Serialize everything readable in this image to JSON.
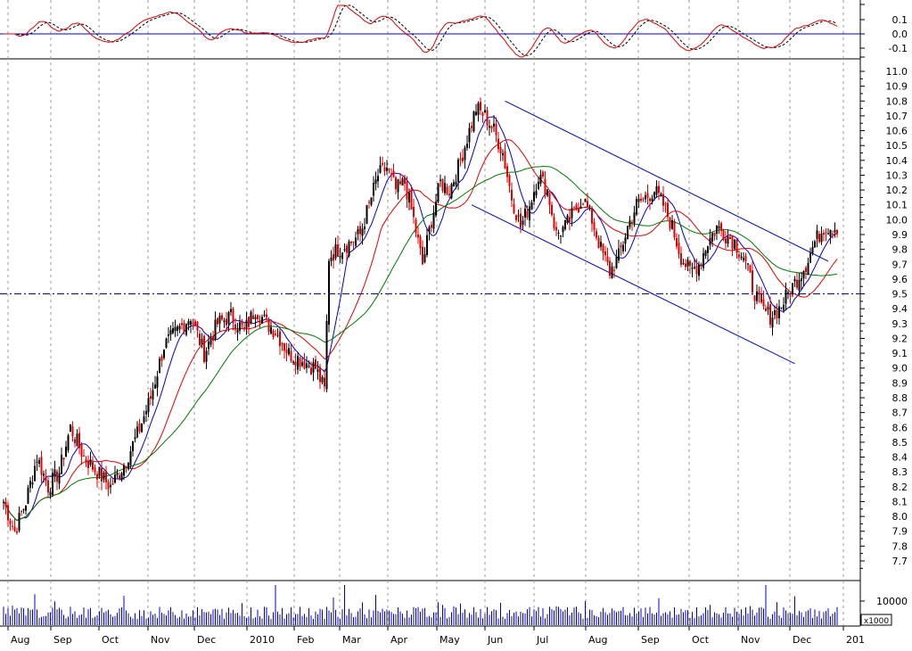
{
  "chart_data": {
    "type": "candlestick",
    "x_labels": [
      "Aug",
      "Sep",
      "Oct",
      "Nov",
      "Dec",
      "2010",
      "Feb",
      "Mar",
      "Apr",
      "May",
      "Jun",
      "Jul",
      "Aug",
      "Sep",
      "Oct",
      "Nov",
      "Dec",
      "201"
    ],
    "price_axis": {
      "ylim": [
        7.6,
        11.1
      ],
      "ticks": [
        "7.7",
        "7.8",
        "7.9",
        "8.0",
        "8.1",
        "8.2",
        "8.3",
        "8.4",
        "8.5",
        "8.6",
        "8.7",
        "8.8",
        "8.9",
        "9.0",
        "9.1",
        "9.2",
        "9.3",
        "9.4",
        "9.5",
        "9.6",
        "9.7",
        "9.8",
        "9.9",
        "10.0",
        "10.1",
        "10.2",
        "10.3",
        "10.4",
        "10.5",
        "10.6",
        "10.7",
        "10.8",
        "10.9",
        "11.0"
      ],
      "support_level": 9.5
    },
    "oscillator": {
      "ylim": [
        -0.18,
        0.2
      ],
      "ticks": [
        "0.1",
        "0.0",
        "-0.1"
      ],
      "zero_line": 0.0
    },
    "volume": {
      "ticks": [
        "10000"
      ],
      "multiplier": "x1000"
    },
    "price_anchors": [
      [
        0,
        8.1
      ],
      [
        5,
        7.9
      ],
      [
        10,
        8.1
      ],
      [
        15,
        8.4
      ],
      [
        20,
        8.2
      ],
      [
        25,
        8.3
      ],
      [
        30,
        8.6
      ],
      [
        36,
        8.4
      ],
      [
        42,
        8.3
      ],
      [
        48,
        8.2
      ],
      [
        54,
        8.35
      ],
      [
        60,
        8.55
      ],
      [
        66,
        8.8
      ],
      [
        72,
        9.15
      ],
      [
        78,
        9.25
      ],
      [
        84,
        9.35
      ],
      [
        90,
        9.1
      ],
      [
        96,
        9.3
      ],
      [
        102,
        9.35
      ],
      [
        108,
        9.25
      ],
      [
        113,
        9.4
      ],
      [
        118,
        9.3
      ],
      [
        122,
        9.25
      ],
      [
        128,
        9.1
      ],
      [
        134,
        9.05
      ],
      [
        140,
        9.0
      ],
      [
        144,
        8.85
      ],
      [
        146,
        9.75
      ],
      [
        150,
        9.8
      ],
      [
        156,
        9.85
      ],
      [
        160,
        9.9
      ],
      [
        164,
        10.1
      ],
      [
        168,
        10.3
      ],
      [
        172,
        10.35
      ],
      [
        176,
        10.2
      ],
      [
        180,
        10.25
      ],
      [
        184,
        10.0
      ],
      [
        188,
        9.7
      ],
      [
        192,
        10.0
      ],
      [
        196,
        10.25
      ],
      [
        200,
        10.2
      ],
      [
        204,
        10.35
      ],
      [
        208,
        10.55
      ],
      [
        212,
        10.75
      ],
      [
        216,
        10.7
      ],
      [
        220,
        10.6
      ],
      [
        224,
        10.45
      ],
      [
        228,
        10.15
      ],
      [
        232,
        9.95
      ],
      [
        236,
        10.1
      ],
      [
        240,
        10.3
      ],
      [
        244,
        10.2
      ],
      [
        248,
        9.9
      ],
      [
        252,
        9.95
      ],
      [
        256,
        10.05
      ],
      [
        260,
        10.15
      ],
      [
        264,
        10.0
      ],
      [
        268,
        9.8
      ],
      [
        272,
        9.65
      ],
      [
        276,
        9.75
      ],
      [
        280,
        9.95
      ],
      [
        284,
        10.1
      ],
      [
        288,
        10.15
      ],
      [
        292,
        10.2
      ],
      [
        296,
        10.1
      ],
      [
        300,
        9.95
      ],
      [
        304,
        9.75
      ],
      [
        308,
        9.65
      ],
      [
        312,
        9.7
      ],
      [
        316,
        9.85
      ],
      [
        320,
        9.95
      ],
      [
        324,
        9.9
      ],
      [
        328,
        9.85
      ],
      [
        332,
        9.75
      ],
      [
        336,
        9.55
      ],
      [
        340,
        9.4
      ],
      [
        344,
        9.35
      ],
      [
        348,
        9.4
      ],
      [
        352,
        9.5
      ],
      [
        356,
        9.6
      ],
      [
        360,
        9.7
      ],
      [
        364,
        9.85
      ],
      [
        368,
        9.95
      ]
    ],
    "channel_upper": [
      [
        225,
        10.8
      ],
      [
        370,
        9.72
      ]
    ],
    "channel_lower": [
      [
        210,
        10.1
      ],
      [
        355,
        9.03
      ]
    ]
  }
}
